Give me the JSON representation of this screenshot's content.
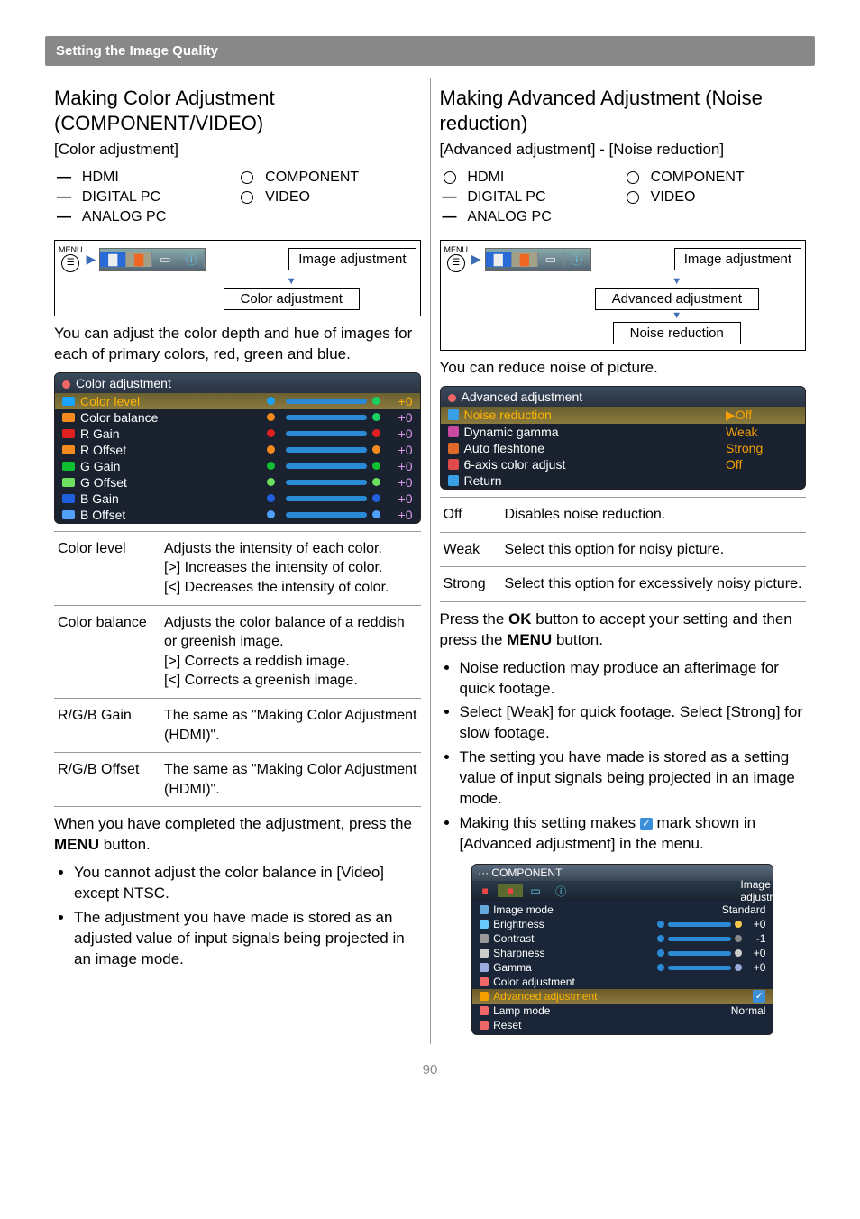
{
  "header": "Setting the Image Quality",
  "pagenum": "90",
  "left": {
    "h2": "Making Color Adjustment (COMPONENT/VIDEO)",
    "sub": "[Color adjustment]",
    "compat": [
      {
        "label": "HDMI",
        "mark": "dash"
      },
      {
        "label": "COMPONENT",
        "mark": "circ"
      },
      {
        "label": "DIGITAL PC",
        "mark": "dash"
      },
      {
        "label": "VIDEO",
        "mark": "circ"
      },
      {
        "label": "ANALOG PC",
        "mark": "dash"
      }
    ],
    "flow_label": "Image adjustment",
    "flow_box1": "Color adjustment",
    "p1": "You can adjust the color depth and hue of images for each of primary colors, red, green and blue.",
    "ss_title": "Color adjustment",
    "ss_rows": [
      {
        "name": "Color level",
        "val": "+0",
        "hl": true,
        "c1": "#1aa3ff",
        "c2": "#19d060"
      },
      {
        "name": "Color balance",
        "val": "+0",
        "c1": "#f58a1f",
        "c2": "#19d060"
      },
      {
        "name": "R Gain",
        "val": "+0",
        "c1": "#e02020",
        "c2": "#e02020"
      },
      {
        "name": "R Offset",
        "val": "+0",
        "c1": "#f58a1f",
        "c2": "#f58a1f"
      },
      {
        "name": "G Gain",
        "val": "+0",
        "c1": "#10c030",
        "c2": "#10c030"
      },
      {
        "name": "G Offset",
        "val": "+0",
        "c1": "#6ee060",
        "c2": "#6ee060"
      },
      {
        "name": "B Gain",
        "val": "+0",
        "c1": "#2060e0",
        "c2": "#2060e0"
      },
      {
        "name": "B Offset",
        "val": "+0",
        "c1": "#50a0ff",
        "c2": "#50a0ff"
      }
    ],
    "defs": [
      {
        "t": "Color level",
        "d": "Adjusts the intensity of each color.\n[>]  Increases the intensity of color.\n[<]  Decreases the intensity of color."
      },
      {
        "t": "Color balance",
        "d": "Adjusts the color balance of a reddish or greenish image.\n[>] Corrects a reddish image.\n[<] Corrects a greenish image."
      },
      {
        "t": "R/G/B Gain",
        "d": "The same as \"Making Color Adjustment (HDMI)\"."
      },
      {
        "t": "R/G/B Offset",
        "d": "The same as \"Making Color Adjustment (HDMI)\"."
      }
    ],
    "p2_a": "When you have completed the adjustment, press the ",
    "p2_b": "MENU",
    "p2_c": " button.",
    "bullets": [
      "You cannot adjust the color balance in [Video] except NTSC.",
      "The adjustment you have made is stored as an adjusted value of input signals being projected in an image mode."
    ]
  },
  "right": {
    "h2": "Making Advanced Adjustment (Noise reduction)",
    "sub": "[Advanced adjustment] - [Noise reduction]",
    "compat": [
      {
        "label": "HDMI",
        "mark": "circ"
      },
      {
        "label": "COMPONENT",
        "mark": "circ"
      },
      {
        "label": "DIGITAL PC",
        "mark": "dash"
      },
      {
        "label": "VIDEO",
        "mark": "circ"
      },
      {
        "label": "ANALOG PC",
        "mark": "dash"
      }
    ],
    "flow_label": "Image adjustment",
    "flow_box1": "Advanced adjustment",
    "flow_box2": "Noise reduction",
    "p1": "You can reduce noise of picture.",
    "ss_title": "Advanced adjustment",
    "ss_rows": [
      {
        "name": "Noise reduction",
        "opt": "▶Off",
        "hl": true,
        "ic": "#3aa0e6"
      },
      {
        "name": "Dynamic gamma",
        "opt": "Weak",
        "ic": "#c94aa0"
      },
      {
        "name": "Auto fleshtone",
        "opt": "Strong",
        "ic": "#e06a2a"
      },
      {
        "name": "6-axis color adjust",
        "opt": "Off",
        "ic": "#e04a4a"
      },
      {
        "name": "Return",
        "opt": "",
        "ic": "#3aa0e6"
      }
    ],
    "defs": [
      {
        "t": "Off",
        "d": "Disables noise reduction."
      },
      {
        "t": "Weak",
        "d": "Select this option for noisy picture."
      },
      {
        "t": "Strong",
        "d": "Select this option for excessively noisy picture."
      }
    ],
    "p2_a": "Press the ",
    "p2_b": "OK",
    "p2_c": " button to accept your setting and then press the ",
    "p2_d": "MENU",
    "p2_e": " button.",
    "bullets": [
      "Noise reduction may produce an afterimage for quick footage.",
      "Select [Weak] for quick footage. Select [Strong] for slow footage.",
      "The setting you have made is stored as a setting value of input signals being projected in an image mode."
    ],
    "b4_a": "Making this setting makes ",
    "b4_b": " mark shown in [Advanced adjustment] in the menu.",
    "menu2": {
      "titlebar": "··· COMPONENT",
      "label": "Image adjustment",
      "rows": [
        {
          "n": "Image mode",
          "v": "Standard",
          "bar": false,
          "ic": "#6ad"
        },
        {
          "n": "Brightness",
          "v": "+0",
          "bar": true,
          "ic": "#6cf",
          "bc1": "#2a8ad6",
          "bc2": "#f7c948"
        },
        {
          "n": "Contrast",
          "v": "-1",
          "bar": true,
          "ic": "#999",
          "bc1": "#2a8ad6",
          "bc2": "#888"
        },
        {
          "n": "Sharpness",
          "v": "+0",
          "bar": true,
          "ic": "#ccc",
          "bc1": "#2a8ad6",
          "bc2": "#ccc"
        },
        {
          "n": "Gamma",
          "v": "+0",
          "bar": true,
          "ic": "#9ad",
          "bc1": "#2a8ad6",
          "bc2": "#9ad"
        },
        {
          "n": "Color adjustment",
          "v": "",
          "bar": false,
          "ic": "#e66"
        },
        {
          "n": "Advanced adjustment",
          "v": "",
          "bar": false,
          "hl": true,
          "check": true,
          "ic": "#f7a000"
        },
        {
          "n": "Lamp mode",
          "v": "Normal",
          "bar": false,
          "ic": "#e66"
        },
        {
          "n": "Reset",
          "v": "",
          "bar": false,
          "ic": "#e66"
        }
      ]
    }
  },
  "menu_word": "MENU"
}
